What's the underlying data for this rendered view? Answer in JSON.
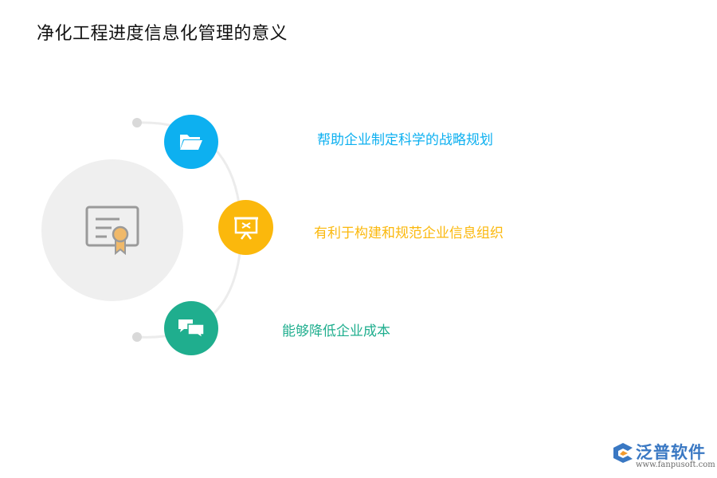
{
  "title": "净化工程进度信息化管理的意义",
  "items": [
    {
      "label": "帮助企业制定科学的战略规划",
      "color": "#0db0f0",
      "icon": "folder-icon"
    },
    {
      "label": "有利于构建和规范企业信息组织",
      "color": "#fbb80c",
      "icon": "presentation-board-icon"
    },
    {
      "label": "能够降低企业成本",
      "color": "#1fae8e",
      "icon": "chat-bubbles-icon"
    }
  ],
  "center_icon": "certificate-icon",
  "brand": {
    "name": "泛普软件",
    "url": "www.fanpusoft.com"
  }
}
